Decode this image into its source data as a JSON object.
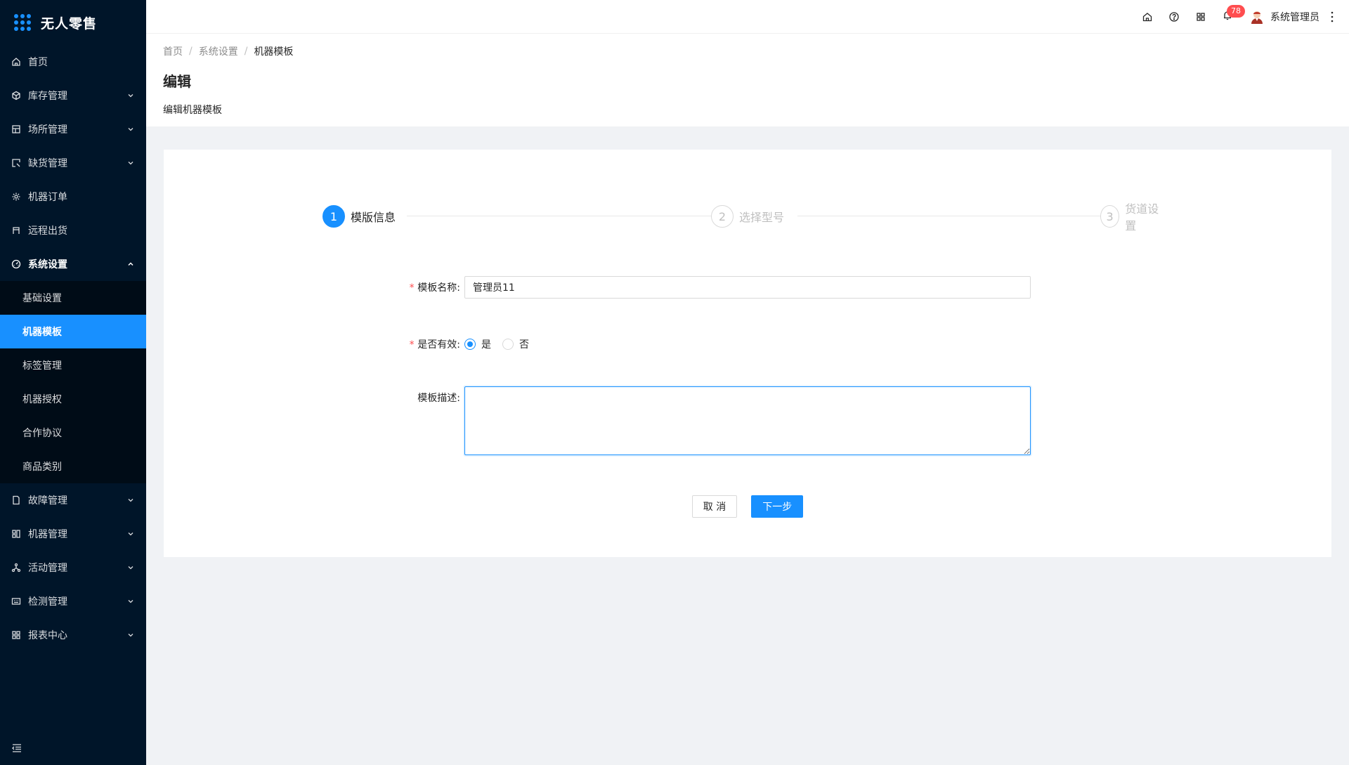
{
  "app": {
    "name": "无人零售"
  },
  "sidebar": {
    "items": [
      {
        "label": "首页",
        "icon": "home-icon",
        "expandable": false
      },
      {
        "label": "库存管理",
        "icon": "inventory-icon",
        "expandable": true
      },
      {
        "label": "场所管理",
        "icon": "venue-icon",
        "expandable": true
      },
      {
        "label": "缺货管理",
        "icon": "shortage-icon",
        "expandable": true
      },
      {
        "label": "机器订单",
        "icon": "order-icon",
        "expandable": false
      },
      {
        "label": "远程出货",
        "icon": "remote-icon",
        "expandable": false
      },
      {
        "label": "系统设置",
        "icon": "settings-icon",
        "expandable": true,
        "open": true
      }
    ],
    "submenu": [
      {
        "label": "基础设置",
        "active": false
      },
      {
        "label": "机器模板",
        "active": true
      },
      {
        "label": "标签管理",
        "active": false
      },
      {
        "label": "机器授权",
        "active": false
      },
      {
        "label": "合作协议",
        "active": false
      },
      {
        "label": "商品类别",
        "active": false
      }
    ],
    "items_after": [
      {
        "label": "故障管理",
        "icon": "fault-icon"
      },
      {
        "label": "机器管理",
        "icon": "machine-icon"
      },
      {
        "label": "活动管理",
        "icon": "activity-icon"
      },
      {
        "label": "检测管理",
        "icon": "detect-icon"
      },
      {
        "label": "报表中心",
        "icon": "report-icon"
      }
    ]
  },
  "header": {
    "notification_count": "78",
    "user_name": "系统管理员"
  },
  "breadcrumb": {
    "home": "首页",
    "parent": "系统设置",
    "current": "机器模板"
  },
  "page": {
    "title": "编辑",
    "description": "编辑机器模板"
  },
  "steps": [
    {
      "num": "1",
      "title": "模版信息",
      "active": true
    },
    {
      "num": "2",
      "title": "选择型号",
      "active": false
    },
    {
      "num": "3",
      "title": "货道设置",
      "active": false
    }
  ],
  "form": {
    "name_label": "模板名称:",
    "name_value": "管理员11",
    "valid_label": "是否有效:",
    "valid_yes": "是",
    "valid_no": "否",
    "valid_selected": "是",
    "desc_label": "模板描述:",
    "desc_value": ""
  },
  "buttons": {
    "cancel": "取 消",
    "next": "下一步"
  },
  "colors": {
    "sidebar_bg": "#001529",
    "primary": "#1890ff",
    "badge": "#ff4d4f"
  }
}
